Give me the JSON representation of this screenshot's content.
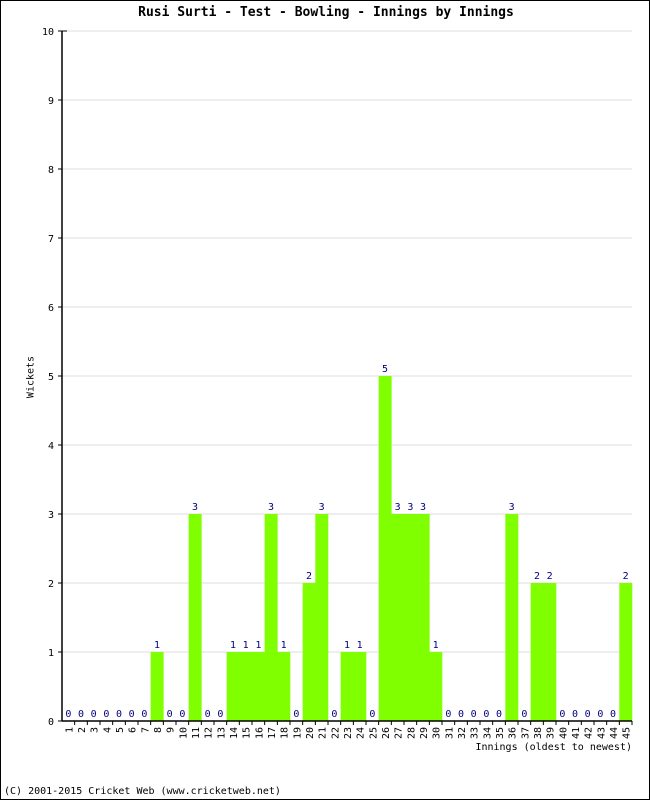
{
  "chart_data": {
    "type": "bar",
    "title": "Rusi Surti - Test - Bowling - Innings by Innings",
    "xlabel": "Innings (oldest to newest)",
    "ylabel": "Wickets",
    "ylim": [
      0,
      10
    ],
    "yticks": [
      0,
      1,
      2,
      3,
      4,
      5,
      6,
      7,
      8,
      9,
      10
    ],
    "grid": true,
    "bar_color": "#80ff00",
    "label_color": "#000080",
    "categories": [
      "1",
      "2",
      "3",
      "4",
      "5",
      "6",
      "7",
      "8",
      "9",
      "10",
      "11",
      "12",
      "13",
      "14",
      "15",
      "16",
      "17",
      "18",
      "19",
      "20",
      "21",
      "22",
      "23",
      "24",
      "25",
      "26",
      "27",
      "28",
      "29",
      "30",
      "31",
      "32",
      "33",
      "34",
      "35",
      "36",
      "37",
      "38",
      "39",
      "40",
      "41",
      "42",
      "43",
      "44",
      "45"
    ],
    "values": [
      0,
      0,
      0,
      0,
      0,
      0,
      0,
      1,
      0,
      0,
      3,
      0,
      0,
      1,
      1,
      1,
      3,
      1,
      0,
      2,
      3,
      0,
      1,
      1,
      0,
      5,
      3,
      3,
      3,
      1,
      0,
      0,
      0,
      0,
      0,
      3,
      0,
      2,
      2,
      0,
      0,
      0,
      0,
      0,
      2
    ]
  },
  "footer": "(C) 2001-2015 Cricket Web (www.cricketweb.net)"
}
